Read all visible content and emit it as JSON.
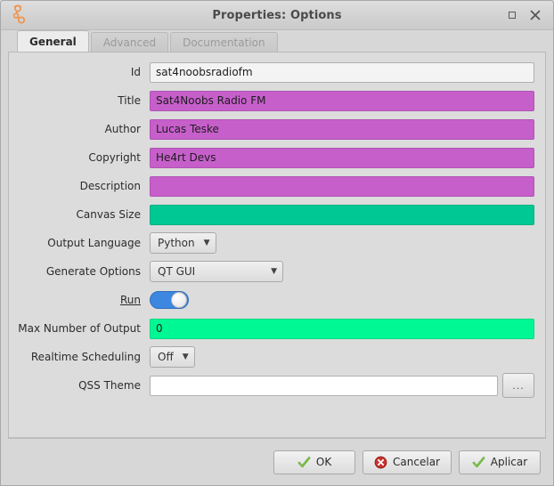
{
  "window": {
    "title": "Properties: Options",
    "app_icon": "gnuradio-options-icon",
    "controls": [
      {
        "name": "maximize-button",
        "glyph": "□"
      },
      {
        "name": "close-button",
        "glyph": "✕"
      }
    ]
  },
  "tabs": [
    {
      "label": "General",
      "active": true
    },
    {
      "label": "Advanced",
      "active": false
    },
    {
      "label": "Documentation",
      "active": false
    }
  ],
  "form": {
    "rows": [
      {
        "label": "Id",
        "type": "text",
        "value": "sat4noobsradiofm",
        "style": "default"
      },
      {
        "label": "Title",
        "type": "text",
        "value": "Sat4Noobs Radio FM",
        "style": "magenta"
      },
      {
        "label": "Author",
        "type": "text",
        "value": "Lucas Teske",
        "style": "magenta"
      },
      {
        "label": "Copyright",
        "type": "text",
        "value": "He4rt Devs",
        "style": "magenta"
      },
      {
        "label": "Description",
        "type": "text",
        "value": "",
        "style": "magenta"
      },
      {
        "label": "Canvas Size",
        "type": "text",
        "value": "",
        "style": "teal"
      },
      {
        "label": "Output Language",
        "type": "combo",
        "value": "Python",
        "style": "auto"
      },
      {
        "label": "Generate Options",
        "type": "combo",
        "value": "QT GUI",
        "style": "wide"
      },
      {
        "label": "Run",
        "type": "toggle",
        "value": "on",
        "underline": true
      },
      {
        "label": "Max Number of Output",
        "type": "text",
        "value": "0",
        "style": "spring"
      },
      {
        "label": "Realtime Scheduling",
        "type": "combo",
        "value": "Off",
        "style": "auto"
      },
      {
        "label": "QSS Theme",
        "type": "file",
        "value": "",
        "style": "plain",
        "browse_label": "..."
      }
    ]
  },
  "buttons": [
    {
      "label": "OK",
      "icon": "check-icon",
      "name": "ok-button"
    },
    {
      "label": "Cancelar",
      "icon": "cancel-icon",
      "name": "cancel-button"
    },
    {
      "label": "Aplicar",
      "icon": "check-icon",
      "name": "apply-button"
    }
  ],
  "colors": {
    "magenta": "#c75fcb",
    "teal": "#00c894",
    "spring_green": "#00f894",
    "toggle_on": "#3d87e0",
    "accent_icon_orange": "#f0924a",
    "window_bg": "#d7d7d7"
  }
}
